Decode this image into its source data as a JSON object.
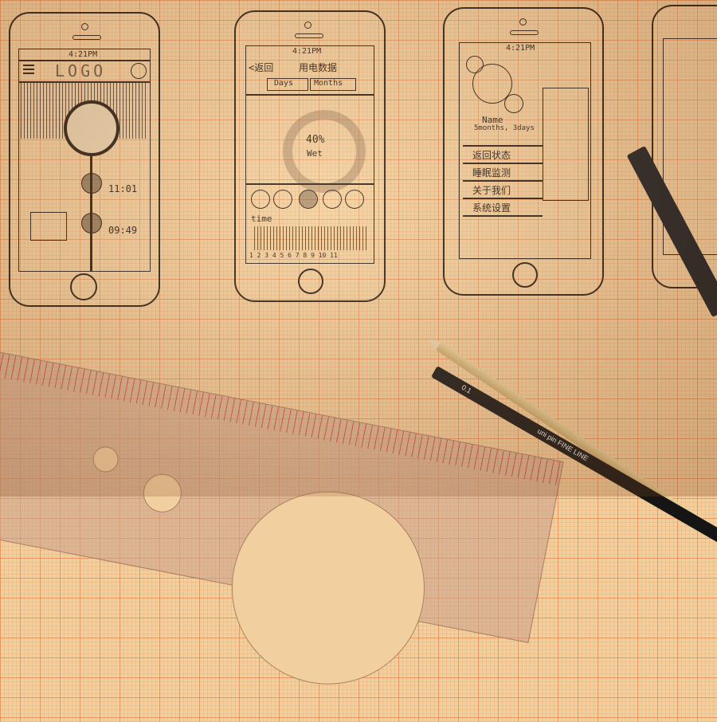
{
  "phone1": {
    "status_time": "4:21PM",
    "logo": "LOGO",
    "time_a": "11:01",
    "time_b": "09:49"
  },
  "phone2": {
    "status_time": "4:21PM",
    "back": "<返回",
    "title": "用电数据",
    "tab_days": "Days",
    "tab_months": "Months",
    "percent": "40%",
    "wet": "Wet",
    "time_label": "time",
    "axis": "1 2 3 4 5 6 7 8 9 10 11"
  },
  "phone3": {
    "status_time": "4:21PM",
    "name": "Name",
    "age": "5months, 3days",
    "menu": [
      "返回状态",
      "睡眠监测",
      "关于我们",
      "系统设置"
    ]
  },
  "pen_label": "uni pin FINE LINE",
  "pen_size": "0.1",
  "colors": {
    "ink": "#2a1d14",
    "paper": "#f2cf9e",
    "grid": "#e2783c"
  }
}
